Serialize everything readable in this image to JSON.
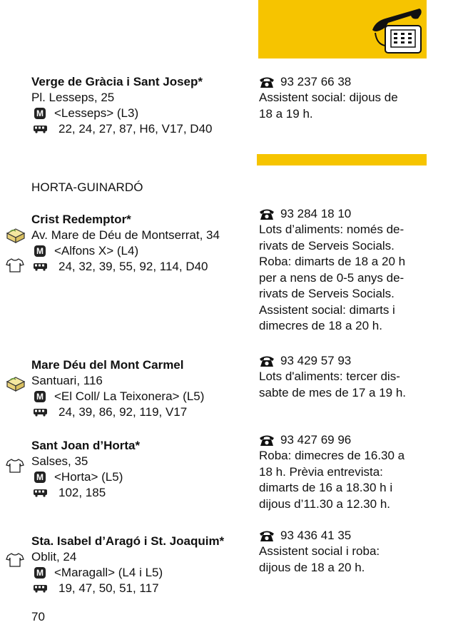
{
  "district": "HORTA-GUINARDÓ",
  "page_number": "70",
  "colors": {
    "accent": "#f6c400",
    "text": "#111111"
  },
  "icons": {
    "phone": "telephone-icon",
    "metro": "metro-icon",
    "bus": "bus-icon",
    "food": "food-parcel-icon",
    "clothes": "t-shirt-icon"
  },
  "entries": [
    {
      "name": "Verge de Gràcia i Sant Josep*",
      "address": "Pl. Lesseps, 25",
      "metro": "<Lesseps> (L3)",
      "bus": "22, 24, 27, 87, H6, V17, D40",
      "phone": "93 237 66 38",
      "notes": [
        "Assistent social: dijous de",
        "18 a 19 h."
      ]
    },
    {
      "name": "Crist Redemptor*",
      "address": "Av. Mare de Déu de Montserrat, 34",
      "metro": "<Alfons X> (L4)",
      "bus": "24, 32, 39, 55, 92, 114, D40",
      "phone": "93 284 18 10",
      "notes": [
        "Lots d’aliments: només de-",
        "rivats de Serveis Socials.",
        "Roba: dimarts de 18 a 20 h",
        "per a nens de 0-5 anys de-",
        "rivats de Serveis Socials.",
        "Assistent social: dimarts i",
        "dimecres de 18 a 20 h."
      ]
    },
    {
      "name": "Mare Déu del Mont Carmel",
      "address": "Santuari, 116",
      "metro": "<El Coll/ La Teixonera> (L5)",
      "bus": "24, 39, 86, 92, 119, V17",
      "phone": "93 429 57 93",
      "notes": [
        "Lots d'aliments: tercer dis-",
        "sabte de mes de 17 a 19 h."
      ]
    },
    {
      "name": "Sant Joan d’Horta*",
      "address": "Salses, 35",
      "metro": "<Horta> (L5)",
      "bus": "102, 185",
      "phone": "93 427 69 96",
      "notes": [
        "Roba: dimecres de 16.30 a",
        "18 h. Prèvia entrevista:",
        "dimarts de 16 a 18.30 h i",
        "dijous d’11.30 a 12.30 h."
      ]
    },
    {
      "name": "Sta. Isabel d’Aragó i St. Joaquim*",
      "address": "Oblit, 24",
      "metro": "<Maragall> (L4 i L5)",
      "bus": "19, 47, 50, 51, 117",
      "phone": "93 436 41 35",
      "notes": [
        "Assistent social i roba:",
        "dijous de 18 a 20 h."
      ]
    }
  ]
}
